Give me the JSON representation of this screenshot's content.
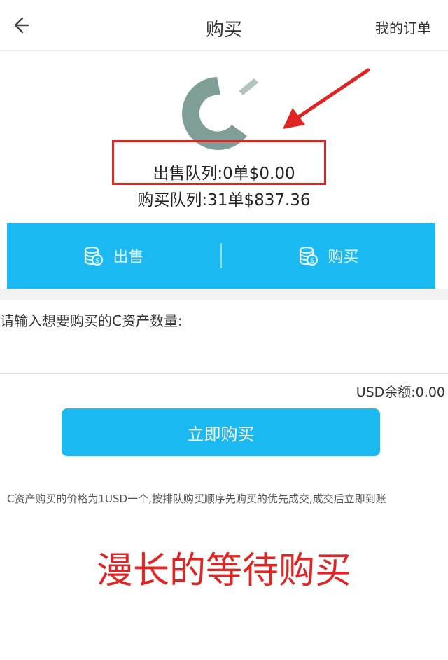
{
  "header": {
    "title": "购买",
    "my_orders": "我的订单"
  },
  "queue": {
    "sell": "出售队列:0单$0.00",
    "buy": "购买队列:31单$837.36"
  },
  "tabs": [
    {
      "label": "出售"
    },
    {
      "label": "购买"
    }
  ],
  "form": {
    "quantity_label": "请输入想要购买的C资产数量:",
    "quantity_value": "",
    "balance": "USD余额:0.00",
    "submit_label": "立即购买"
  },
  "note": "C资产购买的价格为1USD一个,按排队购买顺序先购买的优先成交,成交后立即到账",
  "annotation": {
    "caption": "漫长的等待购买",
    "color": "#e02424"
  },
  "colors": {
    "accent": "#1ab9f2",
    "logo": "#7f9e98"
  }
}
